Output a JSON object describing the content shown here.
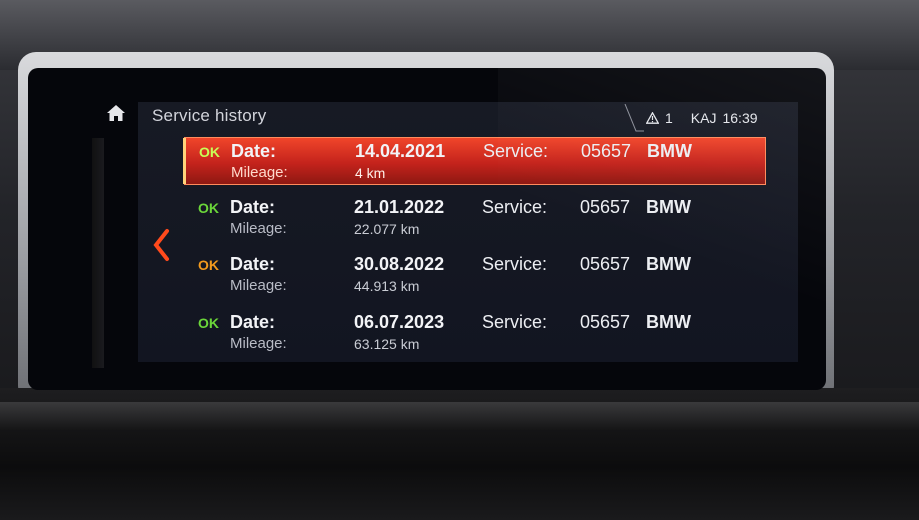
{
  "header": {
    "title": "Service history",
    "warning_count": "1",
    "driver": "KAJ",
    "time": "16:39"
  },
  "icons": {
    "home": "home-icon",
    "back": "chevron-left-icon",
    "warning": "warning-triangle-icon"
  },
  "labels": {
    "date": "Date:",
    "mileage": "Mileage:",
    "service": "Service:"
  },
  "records": [
    {
      "status": "OK",
      "status_color": "#6bd63a",
      "date": "14.04.2021",
      "mileage": "4 km",
      "code": "05657",
      "brand": "BMW",
      "selected": true
    },
    {
      "status": "OK",
      "status_color": "#6bd63a",
      "date": "21.01.2022",
      "mileage": "22.077 km",
      "code": "05657",
      "brand": "BMW",
      "selected": false
    },
    {
      "status": "OK",
      "status_color": "#f29a1e",
      "date": "30.08.2022",
      "mileage": "44.913 km",
      "code": "05657",
      "brand": "BMW",
      "selected": false
    },
    {
      "status": "OK",
      "status_color": "#6bd63a",
      "date": "06.07.2023",
      "mileage": "63.125 km",
      "code": "05657",
      "brand": "BMW",
      "selected": false
    }
  ],
  "colors": {
    "accent": "#e0351f",
    "ok_green": "#6bd63a",
    "ok_orange": "#f29a1e"
  }
}
